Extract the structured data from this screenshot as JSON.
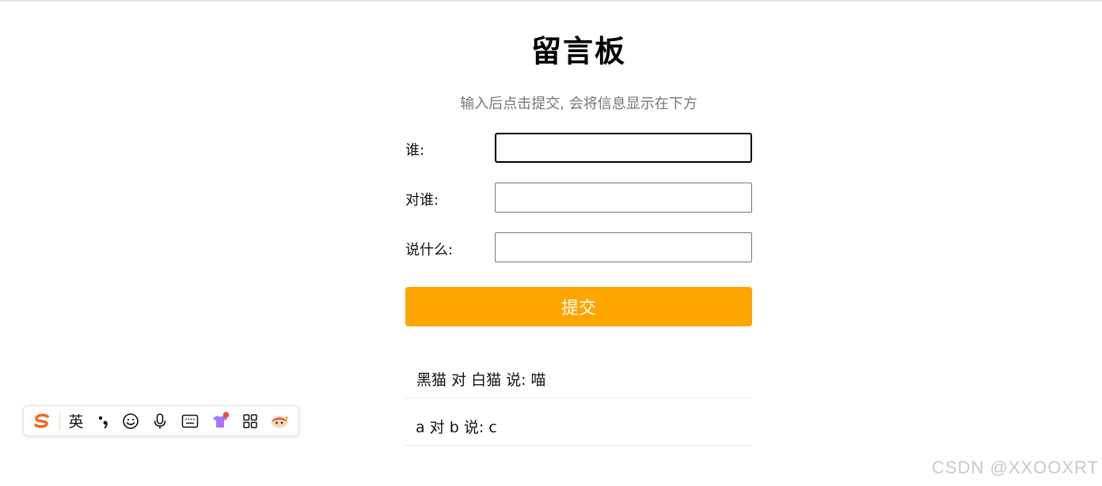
{
  "page": {
    "title": "留言板",
    "subtitle": "输入后点击提交, 会将信息显示在下方"
  },
  "form": {
    "from_label": "谁:",
    "from_value": "",
    "to_label": "对谁:",
    "to_value": "",
    "message_label": "说什么:",
    "message_value": "",
    "submit_label": "提交"
  },
  "messages": [
    "黑猫 对 白猫 说: 喵",
    "a 对 b 说: c"
  ],
  "ime_toolbar": {
    "logo_icon": "sogou-logo-icon",
    "language_label": "英",
    "icons": [
      "punctuation-icon",
      "emoji-icon",
      "microphone-icon",
      "keyboard-icon",
      "skin-icon",
      "apps-grid-icon",
      "mascot-icon"
    ]
  },
  "watermark": "CSDN @XXOOXRT",
  "colors": {
    "submit_bg": "#ffa500",
    "subtitle": "#777777",
    "ime_logo": "#f26a1b"
  }
}
